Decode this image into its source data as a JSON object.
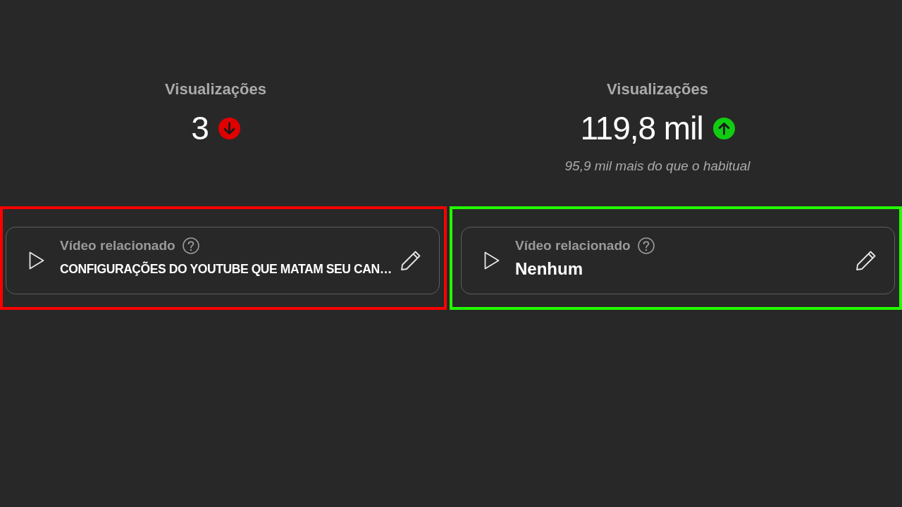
{
  "comparisons": [
    {
      "color": "#ff0000",
      "stat": {
        "label": "Visualizações",
        "value": "3",
        "trend_up": false
      },
      "related_video": {
        "label": "Vídeo relacionado",
        "title": "CONFIGURAÇÕES DO YOUTUBE QUE MATAM SEU CAN…"
      }
    },
    {
      "color": "#22ff00",
      "stat": {
        "label": "Visualizações",
        "value": "119,8 mil",
        "trend_up": true,
        "note": "95,9 mil mais do que o habitual"
      },
      "related_video": {
        "label": "Vídeo relacionado",
        "title": "Nenhum"
      }
    }
  ]
}
